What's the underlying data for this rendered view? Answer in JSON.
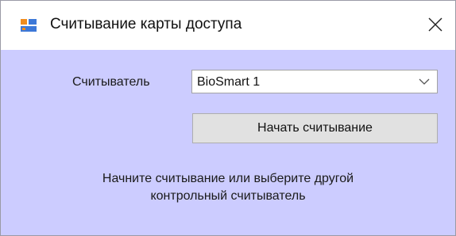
{
  "window": {
    "title": "Считывание карты доступа",
    "icons": {
      "app": "app-window-icon",
      "close": "close-icon"
    }
  },
  "form": {
    "reader_label": "Считыватель",
    "reader_select": {
      "selected": "BioSmart 1",
      "icon": "chevron-down-icon"
    },
    "start_button_label": "Начать считывание"
  },
  "message": {
    "line1": "Начните считывание или выберите другой",
    "line2": "контрольный считыватель"
  },
  "colors": {
    "client_background": "#ccccff",
    "button_background": "#e1e1e1",
    "icon_orange": "#f08c1e",
    "icon_blue": "#3c78d8"
  }
}
